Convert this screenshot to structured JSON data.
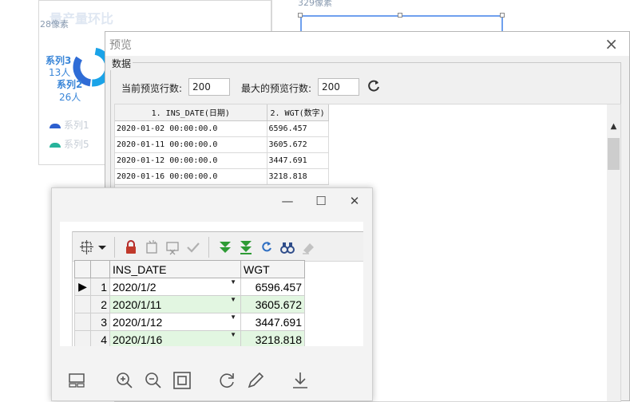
{
  "background": {
    "title": "量产量环比",
    "px_left": "28像素",
    "px_right": "329像素",
    "labels": [
      {
        "name": "系列3",
        "value": "13人"
      },
      {
        "name": "系列2",
        "value": "26人"
      }
    ],
    "legend": [
      "系列1",
      "系列5"
    ],
    "colors": {
      "series3": "#1aa3e8",
      "series2": "#2f6cd6",
      "legend1": "#2d5fcf",
      "legend5": "#27b39b"
    }
  },
  "preview": {
    "title": "预览",
    "close": "×",
    "group_label": "数据",
    "current_rows_label": "当前预览行数:",
    "current_rows_value": "200",
    "max_rows_label": "最大的预览行数:",
    "max_rows_value": "200",
    "columns": [
      "1. INS_DATE(日期)",
      "2. WGT(数字)"
    ],
    "rows": [
      [
        "2020-01-02 00:00:00.0",
        "6596.457"
      ],
      [
        "2020-01-11 00:00:00.0",
        "3605.672"
      ],
      [
        "2020-01-12 00:00:00.0",
        "3447.691"
      ],
      [
        "2020-01-16 00:00:00.0",
        "3218.818"
      ]
    ]
  },
  "viewer": {
    "minimize": "—",
    "maximize": "☐",
    "close": "✕",
    "grid": {
      "columns": [
        "INS_DATE",
        "WGT"
      ],
      "rows": [
        {
          "num": "1",
          "date": "2020/1/2",
          "wgt": "6596.457"
        },
        {
          "num": "2",
          "date": "2020/1/11",
          "wgt": "3605.672"
        },
        {
          "num": "3",
          "date": "2020/1/12",
          "wgt": "3447.691"
        },
        {
          "num": "4",
          "date": "2020/1/16",
          "wgt": "3218.818"
        }
      ]
    }
  }
}
